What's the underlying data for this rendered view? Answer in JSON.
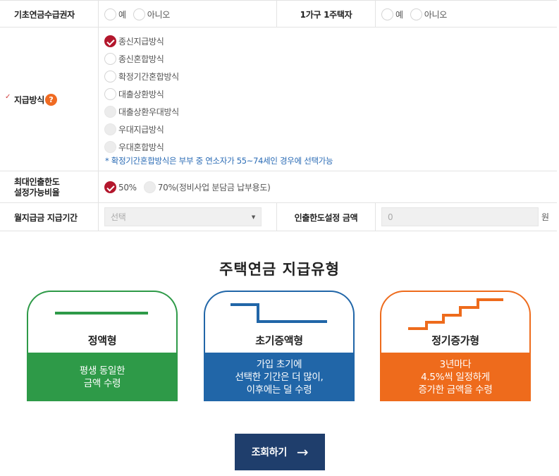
{
  "colors": {
    "accent": "#b3172d",
    "green": "#2e9a48",
    "blue": "#2166a8",
    "orange": "#ee6b1c",
    "button": "#1f3e6c",
    "note": "#2a6bb5"
  },
  "row1": {
    "label_left": "기초연금수급권자",
    "label_right": "1가구 1주택자",
    "yes": "예",
    "no": "아니오"
  },
  "method": {
    "label": "지급방식",
    "help_icon": "question-icon",
    "options": [
      {
        "label": "종신지급방식",
        "state": "checked"
      },
      {
        "label": "종신혼합방식",
        "state": "normal"
      },
      {
        "label": "확정기간혼합방식",
        "state": "normal"
      },
      {
        "label": "대출상환방식",
        "state": "normal"
      },
      {
        "label": "대출상환우대방식",
        "state": "disabled"
      },
      {
        "label": "우대지급방식",
        "state": "disabled"
      },
      {
        "label": "우대혼합방식",
        "state": "disabled"
      }
    ],
    "note": "* 확정기간혼합방식은 부부 중 연소자가 55~74세인 경우에 선택가능"
  },
  "limit": {
    "label_line1": "최대인출한도",
    "label_line2": "설정가능비율",
    "opt1": "50%",
    "opt2": "70%(정비사업 분담금 납부용도)"
  },
  "period": {
    "label": "월지급금 지급기간",
    "select_value": "선택",
    "amount_label": "인출한도설정 금액",
    "amount_placeholder": "0",
    "unit": "원"
  },
  "types": {
    "title": "주택연금 지급유형",
    "cards": [
      {
        "name": "정액형",
        "desc": "평생 동일한\n금액 수령",
        "color": "#2e9a48",
        "icon": "flat-line-icon"
      },
      {
        "name": "초기증액형",
        "desc": "가입 초기에\n선택한 기간은 더 많이,\n이후에는 덜 수령",
        "color": "#2166a8",
        "icon": "step-down-icon"
      },
      {
        "name": "정기증가형",
        "desc": "3년마다\n4.5%씩 일정하게\n증가한 금액을 수령",
        "color": "#ee6b1c",
        "icon": "stairs-up-icon"
      }
    ]
  },
  "submit": {
    "label": "조회하기",
    "arrow": "→"
  }
}
